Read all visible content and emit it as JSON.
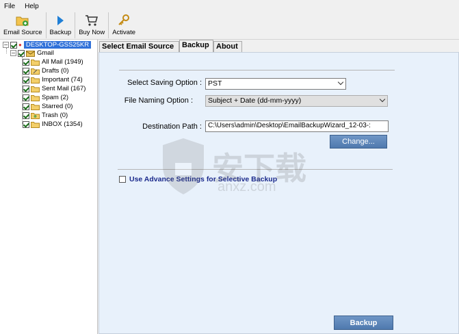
{
  "menu": {
    "items": [
      "File",
      "Help"
    ]
  },
  "toolbar": {
    "email_source": "Email Source",
    "backup": "Backup",
    "buy_now": "Buy Now",
    "activate": "Activate"
  },
  "tree": {
    "root": "DESKTOP-GSS25KR",
    "account": "Gmail",
    "folders": [
      {
        "label": "All Mail (1949)"
      },
      {
        "label": "Drafts (0)"
      },
      {
        "label": "Important (74)"
      },
      {
        "label": "Sent Mail (167)"
      },
      {
        "label": "Spam (2)"
      },
      {
        "label": "Starred (0)"
      },
      {
        "label": "Trash (0)"
      },
      {
        "label": "INBOX (1354)"
      }
    ]
  },
  "tabs": [
    {
      "label": "Select Email Source"
    },
    {
      "label": "Backup"
    },
    {
      "label": "About"
    }
  ],
  "form": {
    "saving_option_label": "Select Saving Option :",
    "saving_option_value": "PST",
    "naming_option_label": "File Naming Option :",
    "naming_option_value": "Subject + Date (dd-mm-yyyy)",
    "destination_label": "Destination Path :",
    "destination_value": "C:\\Users\\admin\\Desktop\\EmailBackupWizard_12-03-:",
    "change_button": "Change...",
    "advance_settings": "Use Advance Settings for Selective Backup",
    "backup_button": "Backup"
  },
  "watermark": {
    "text": "安下载",
    "sub": "anxz.com"
  },
  "colors": {
    "accent": "#3071d9",
    "content_bg": "#e8f1fb",
    "button": "#5b83b8"
  }
}
